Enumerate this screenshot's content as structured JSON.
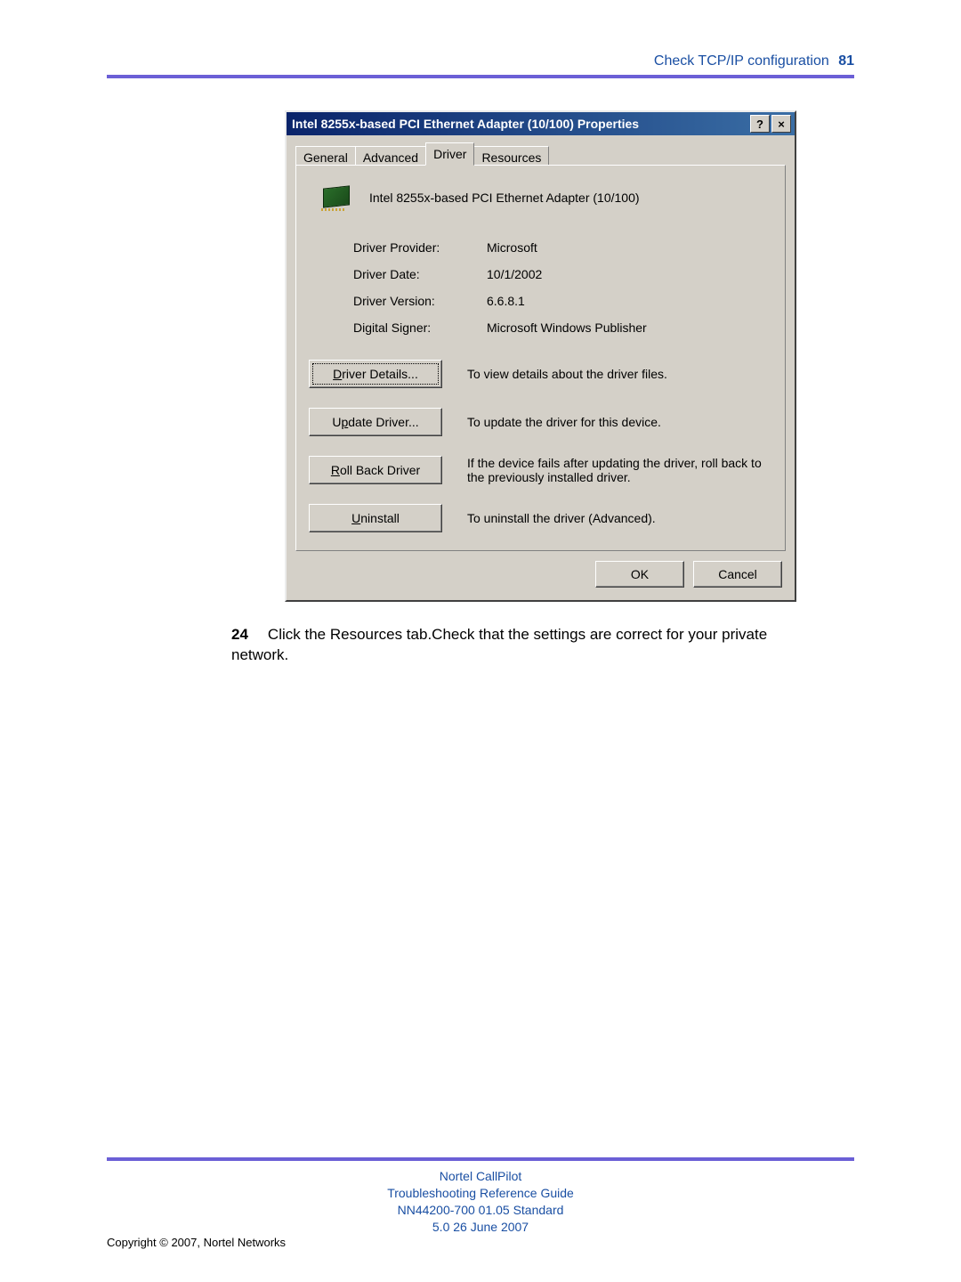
{
  "header": {
    "section_title": "Check TCP/IP configuration",
    "page_number": "81"
  },
  "dialog": {
    "title": "Intel 8255x-based PCI Ethernet Adapter (10/100) Properties",
    "tabs": [
      "General",
      "Advanced",
      "Driver",
      "Resources"
    ],
    "active_tab_index": 2,
    "device_name": "Intel 8255x-based PCI Ethernet Adapter (10/100)",
    "driver_info": {
      "provider_label": "Driver Provider:",
      "provider_value": "Microsoft",
      "date_label": "Driver Date:",
      "date_value": "10/1/2002",
      "version_label": "Driver Version:",
      "version_value": "6.6.8.1",
      "signer_label": "Digital Signer:",
      "signer_value": "Microsoft Windows Publisher"
    },
    "buttons": {
      "details": {
        "pre": "",
        "u": "D",
        "post": "river Details..."
      },
      "details_desc": "To view details about the driver files.",
      "update": {
        "pre": "U",
        "u": "p",
        "post": "date Driver..."
      },
      "update_desc": "To update the driver for this device.",
      "rollback": {
        "pre": "",
        "u": "R",
        "post": "oll Back Driver"
      },
      "rollback_desc": "If the device fails after updating the driver, roll back to the previously installed driver.",
      "uninstall": {
        "pre": "",
        "u": "U",
        "post": "ninstall"
      },
      "uninstall_desc": "To uninstall the driver (Advanced).",
      "ok": "OK",
      "cancel": "Cancel"
    },
    "titlebar_buttons": {
      "help": "?",
      "close": "×"
    }
  },
  "step": {
    "num": "24",
    "text": "Click the Resources tab.Check that the settings are correct for your private network."
  },
  "footer": {
    "line1": "Nortel CallPilot",
    "line2": "Troubleshooting Reference Guide",
    "line3": "NN44200-700   01.05   Standard",
    "line4": "5.0   26 June 2007",
    "copyright": "Copyright © 2007, Nortel Networks"
  }
}
